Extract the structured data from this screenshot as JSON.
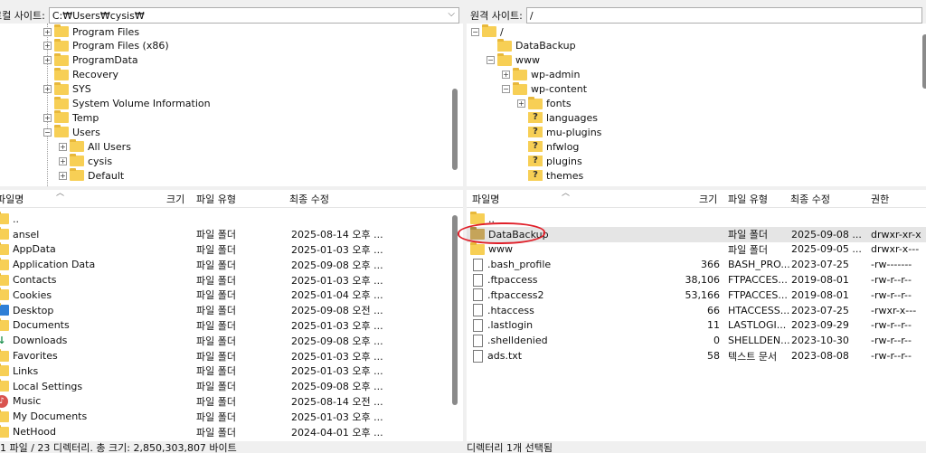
{
  "local": {
    "site_label": "로컬 사이트:",
    "path": "C:₩Users₩cysis₩",
    "tree": [
      {
        "label": "Program Files",
        "exp": "+",
        "indent": 0
      },
      {
        "label": "Program Files (x86)",
        "exp": "+",
        "indent": 0
      },
      {
        "label": "ProgramData",
        "exp": "+",
        "indent": 0
      },
      {
        "label": "Recovery",
        "exp": "",
        "indent": 0
      },
      {
        "label": "SYS",
        "exp": "+",
        "indent": 0
      },
      {
        "label": "System Volume Information",
        "exp": "",
        "indent": 0
      },
      {
        "label": "Temp",
        "exp": "+",
        "indent": 0
      },
      {
        "label": "Users",
        "exp": "-",
        "indent": 0
      },
      {
        "label": "All Users",
        "exp": "+",
        "indent": 1
      },
      {
        "label": "cysis",
        "exp": "+",
        "indent": 1
      },
      {
        "label": "Default",
        "exp": "+",
        "indent": 1
      }
    ],
    "columns": {
      "name": "파일명",
      "size": "크기",
      "type": "파일 유형",
      "modified": "최종 수정"
    },
    "files": [
      {
        "name": "..",
        "type": "",
        "modified": "",
        "icon": "folder"
      },
      {
        "name": "ansel",
        "type": "파일 폴더",
        "modified": "2025-08-14 오후 ...",
        "icon": "folder"
      },
      {
        "name": "AppData",
        "type": "파일 폴더",
        "modified": "2025-01-03 오후 ...",
        "icon": "folder"
      },
      {
        "name": "Application Data",
        "type": "파일 폴더",
        "modified": "2025-09-08 오후 ...",
        "icon": "folder"
      },
      {
        "name": "Contacts",
        "type": "파일 폴더",
        "modified": "2025-01-03 오후 ...",
        "icon": "folder"
      },
      {
        "name": "Cookies",
        "type": "파일 폴더",
        "modified": "2025-01-04 오후 ...",
        "icon": "folder"
      },
      {
        "name": "Desktop",
        "type": "파일 폴더",
        "modified": "2025-09-08 오전 ...",
        "icon": "desktop"
      },
      {
        "name": "Documents",
        "type": "파일 폴더",
        "modified": "2025-01-03 오후 ...",
        "icon": "folder"
      },
      {
        "name": "Downloads",
        "type": "파일 폴더",
        "modified": "2025-09-08 오후 ...",
        "icon": "download"
      },
      {
        "name": "Favorites",
        "type": "파일 폴더",
        "modified": "2025-01-03 오후 ...",
        "icon": "folder"
      },
      {
        "name": "Links",
        "type": "파일 폴더",
        "modified": "2025-01-03 오후 ...",
        "icon": "folder"
      },
      {
        "name": "Local Settings",
        "type": "파일 폴더",
        "modified": "2025-09-08 오후 ...",
        "icon": "folder"
      },
      {
        "name": "Music",
        "type": "파일 폴더",
        "modified": "2025-08-14 오전 ...",
        "icon": "music"
      },
      {
        "name": "My Documents",
        "type": "파일 폴더",
        "modified": "2025-01-03 오후 ...",
        "icon": "folder"
      },
      {
        "name": "NetHood",
        "type": "파일 폴더",
        "modified": "2024-04-01 오후 ...",
        "icon": "folder"
      }
    ],
    "status": "1 파일 / 23 디렉터리. 총 크기: 2,850,303,807 바이트"
  },
  "remote": {
    "site_label": "원격 사이트:",
    "path": "/",
    "tree": [
      {
        "label": "/",
        "exp": "-",
        "indent": 0,
        "icon": "folder"
      },
      {
        "label": "DataBackup",
        "exp": "",
        "indent": 1,
        "icon": "folder"
      },
      {
        "label": "www",
        "exp": "-",
        "indent": 1,
        "icon": "folder"
      },
      {
        "label": "wp-admin",
        "exp": "+",
        "indent": 2,
        "icon": "folder"
      },
      {
        "label": "wp-content",
        "exp": "-",
        "indent": 2,
        "icon": "folder"
      },
      {
        "label": "fonts",
        "exp": "+",
        "indent": 3,
        "icon": "folder"
      },
      {
        "label": "languages",
        "exp": "",
        "indent": 3,
        "icon": "qfolder"
      },
      {
        "label": "mu-plugins",
        "exp": "",
        "indent": 3,
        "icon": "qfolder"
      },
      {
        "label": "nfwlog",
        "exp": "",
        "indent": 3,
        "icon": "qfolder"
      },
      {
        "label": "plugins",
        "exp": "",
        "indent": 3,
        "icon": "qfolder"
      },
      {
        "label": "themes",
        "exp": "",
        "indent": 3,
        "icon": "qfolder"
      }
    ],
    "columns": {
      "name": "파일명",
      "size": "크기",
      "type": "파일 유형",
      "modified": "최종 수정",
      "perm": "권한"
    },
    "files": [
      {
        "name": "..",
        "size": "",
        "type": "",
        "modified": "",
        "perm": "",
        "icon": "folder"
      },
      {
        "name": "DataBackup",
        "size": "",
        "type": "파일 폴더",
        "modified": "2025-09-08 ...",
        "perm": "drwxr-xr-x",
        "icon": "folder-dark",
        "selected": true
      },
      {
        "name": "www",
        "size": "",
        "type": "파일 폴더",
        "modified": "2025-09-05 ...",
        "perm": "drwxr-x---",
        "icon": "folder"
      },
      {
        "name": ".bash_profile",
        "size": "366",
        "type": "BASH_PRO...",
        "modified": "2023-07-25",
        "perm": "-rw-------",
        "icon": "file"
      },
      {
        "name": ".ftpaccess",
        "size": "38,106",
        "type": "FTPACCES...",
        "modified": "2019-08-01",
        "perm": "-rw-r--r--",
        "icon": "file"
      },
      {
        "name": ".ftpaccess2",
        "size": "53,166",
        "type": "FTPACCES...",
        "modified": "2019-08-01",
        "perm": "-rw-r--r--",
        "icon": "file"
      },
      {
        "name": ".htaccess",
        "size": "66",
        "type": "HTACCESS...",
        "modified": "2023-07-25",
        "perm": "-rwxr-x---",
        "icon": "file"
      },
      {
        "name": ".lastlogin",
        "size": "11",
        "type": "LASTLOGI...",
        "modified": "2023-09-29",
        "perm": "-rw-r--r--",
        "icon": "file"
      },
      {
        "name": ".shelldenied",
        "size": "0",
        "type": "SHELLDEN...",
        "modified": "2023-10-30",
        "perm": "-rw-r--r--",
        "icon": "file"
      },
      {
        "name": "ads.txt",
        "size": "58",
        "type": "텍스트 문서",
        "modified": "2023-08-08",
        "perm": "-rw-r--r--",
        "icon": "file"
      }
    ],
    "status": "디렉터리 1개 선택됨"
  },
  "colors": {
    "annotation": "#e0202a",
    "folder": "#f7cf55",
    "selected_row": "#e5e5e5"
  }
}
